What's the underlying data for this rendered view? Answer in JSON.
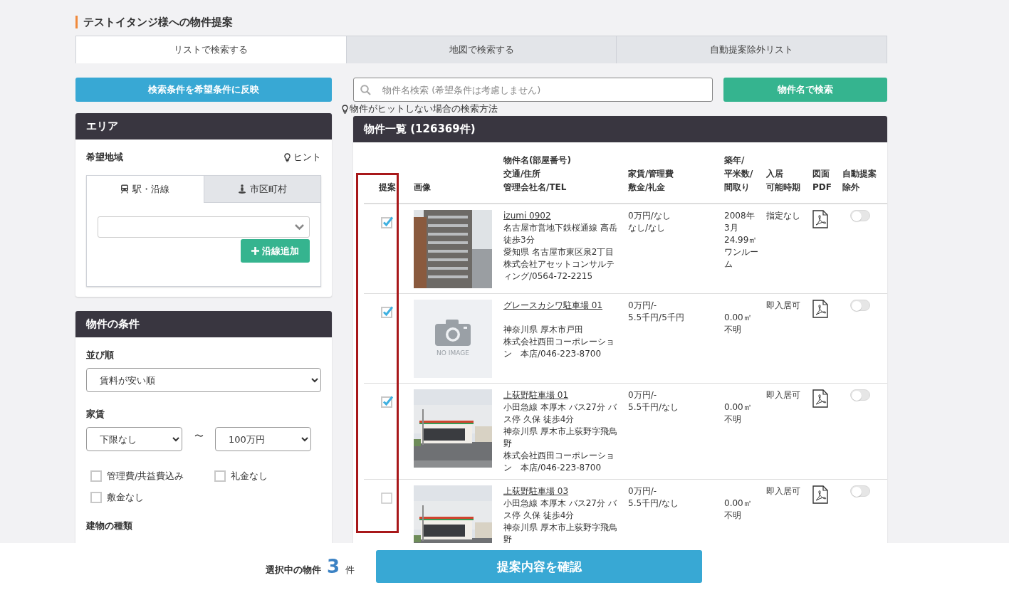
{
  "page_title": "テストイタンジ様への物件提案",
  "tabs": [
    {
      "label": "リストで検索する",
      "selected": true
    },
    {
      "label": "地図で検索する",
      "selected": false
    },
    {
      "label": "自動提案除外リスト",
      "selected": false
    }
  ],
  "reflect_button": "検索条件を希望条件に反映",
  "search": {
    "placeholder": "物件名検索 (希望条件は考慮しません)",
    "button": "物件名で検索",
    "help": "物件がヒットしない場合の検索方法"
  },
  "area_panel": {
    "title": "エリア",
    "label": "希望地域",
    "hint": "ヒント",
    "tabs": [
      {
        "label": "駅・沿線",
        "kind": "train",
        "selected": true
      },
      {
        "label": "市区町村",
        "kind": "person",
        "selected": false
      }
    ],
    "add_button": "沿線追加"
  },
  "conditions_panel": {
    "title": "物件の条件",
    "sort_label": "並び順",
    "sort_value": "賃料が安い順",
    "rent_label": "家賃",
    "rent_min": "下限なし",
    "rent_separator": "〜",
    "rent_max": "100万円",
    "options": [
      {
        "label": "管理費/共益費込み",
        "checked": false
      },
      {
        "label": "礼金なし",
        "checked": false
      },
      {
        "label": "敷金なし",
        "checked": false
      }
    ],
    "building_label": "建物の種類"
  },
  "listing": {
    "title": "物件一覧 (126369件)",
    "columns": [
      [
        "提案"
      ],
      [
        "画像"
      ],
      [
        "物件名(部屋番号)",
        "交通/住所",
        "管理会社名/TEL"
      ],
      [
        "家賃/管理費",
        "敷金/礼金"
      ],
      [
        "築年/",
        "平米数/",
        "間取り"
      ],
      [
        "入居",
        "可能時期"
      ],
      [
        "図面",
        "PDF"
      ],
      [
        "自動提案",
        "除外"
      ]
    ],
    "rows": [
      {
        "proposed": true,
        "image": {
          "kind": "building"
        },
        "name": "izumi 0902",
        "transit": "名古屋市営地下鉄桜通線 高岳徒歩3分",
        "address": "愛知県 名古屋市東区泉2丁目",
        "company": "株式会社アセットコンサルティング/0564-72-2215",
        "rent": [
          "0万円/なし",
          "なし/なし"
        ],
        "built": "2008年3月",
        "area": "24.99㎡",
        "layout": "ワンルーム",
        "move_in": "指定なし",
        "excluded": false
      },
      {
        "proposed": true,
        "image": {
          "kind": "no_image",
          "label": "NO IMAGE"
        },
        "name": "グレースカシワ駐車場 01",
        "address": "神奈川県 厚木市戸田",
        "company": "株式会社西田コーポレーション　本店/046-223-8700",
        "rent": [
          "0万円/-",
          "5.5千円/5千円"
        ],
        "area": "0.00㎡",
        "layout": "不明",
        "move_in": "即入居可",
        "excluded": false
      },
      {
        "proposed": true,
        "image": {
          "kind": "store"
        },
        "name": "上荻野駐車場 01",
        "transit": "小田急線 本厚木 バス27分 バス停 久保 徒歩4分",
        "address": "神奈川県 厚木市上荻野字飛鳥野",
        "company": "株式会社西田コーポレーション　本店/046-223-8700",
        "rent": [
          "0万円/-",
          "5.5千円/なし"
        ],
        "area": "0.00㎡",
        "layout": "不明",
        "move_in": "即入居可",
        "excluded": false
      },
      {
        "proposed": false,
        "image": {
          "kind": "store"
        },
        "name": "上荻野駐車場 03",
        "transit": "小田急線 本厚木 バス27分 バス停 久保 徒歩4分",
        "address": "神奈川県 厚木市上荻野字飛鳥野",
        "rent": [
          "0万円/-",
          "5.5千円/なし"
        ],
        "area": "0.00㎡",
        "layout": "不明",
        "move_in": "即入居可",
        "excluded": false
      }
    ]
  },
  "footer": {
    "selected_label": "選択中の物件",
    "selected_count": "3",
    "count_unit": "件",
    "confirm_button": "提案内容を確認"
  }
}
